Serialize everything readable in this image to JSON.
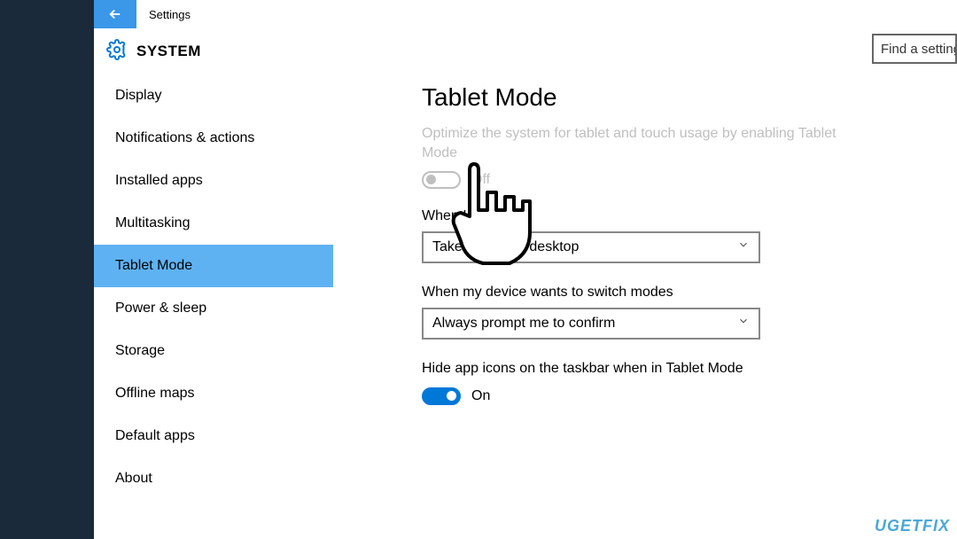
{
  "titlebar": {
    "title": "Settings"
  },
  "header": {
    "title": "SYSTEM",
    "find_placeholder": "Find a setting"
  },
  "sidebar": {
    "items": [
      {
        "label": "Display",
        "selected": false
      },
      {
        "label": "Notifications & actions",
        "selected": false
      },
      {
        "label": "Installed apps",
        "selected": false
      },
      {
        "label": "Multitasking",
        "selected": false
      },
      {
        "label": "Tablet Mode",
        "selected": true
      },
      {
        "label": "Power & sleep",
        "selected": false
      },
      {
        "label": "Storage",
        "selected": false
      },
      {
        "label": "Offline maps",
        "selected": false
      },
      {
        "label": "Default apps",
        "selected": false
      },
      {
        "label": "About",
        "selected": false
      }
    ]
  },
  "main": {
    "title": "Tablet Mode",
    "description": "Optimize the system for tablet and touch usage by enabling Tablet Mode",
    "tablet_toggle": {
      "state": "Off",
      "on": false
    },
    "signin_label": "When I sign in",
    "signin_value": "Take me to the desktop",
    "switch_label": "When my device wants to switch modes",
    "switch_value": "Always prompt me to confirm",
    "hide_icons_label": "Hide app icons on the taskbar when in Tablet Mode",
    "hide_icons_toggle": {
      "state": "On",
      "on": true
    }
  },
  "watermark": "UGETFIX"
}
